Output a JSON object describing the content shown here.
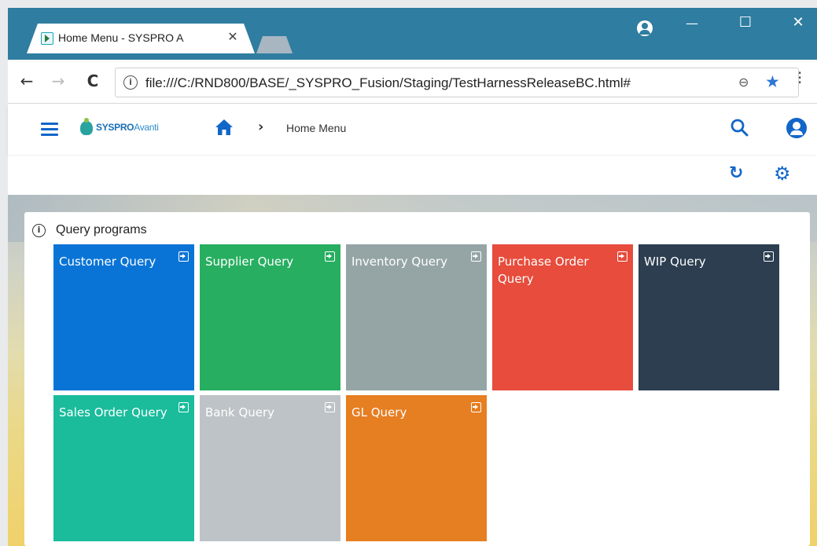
{
  "browser": {
    "tab_title": "Home Menu - SYSPRO A",
    "tab_close": "✕",
    "url": "file:///C:/RND800/BASE/_SYSPRO_Fusion/Staging/TestHarnessReleaseBC.html#",
    "window_controls": {
      "minimize": "—",
      "maximize": "☐",
      "close": "✕"
    },
    "nav": {
      "back": "←",
      "forward": "→",
      "reload": "C"
    }
  },
  "app": {
    "logo": {
      "brand": "SYSPRO",
      "product": "Avanti"
    },
    "breadcrumb": {
      "separator": "›",
      "current": "Home Menu"
    },
    "colors": {
      "accent": "#1266c8",
      "titlebar": "#2f7da0"
    }
  },
  "section": {
    "title": "Query programs",
    "tiles": [
      {
        "label": "Customer Query",
        "color": "#0a74d6"
      },
      {
        "label": "Supplier Query",
        "color": "#27ae60"
      },
      {
        "label": "Inventory Query",
        "color": "#95a5a6"
      },
      {
        "label": "Purchase Order Query",
        "color": "#e74c3c"
      },
      {
        "label": "WIP Query",
        "color": "#2c3e50"
      },
      {
        "label": "Sales Order Query",
        "color": "#1abc9c"
      },
      {
        "label": "Bank Query",
        "color": "#bdc3c7"
      },
      {
        "label": "GL Query",
        "color": "#e67e22"
      }
    ]
  }
}
